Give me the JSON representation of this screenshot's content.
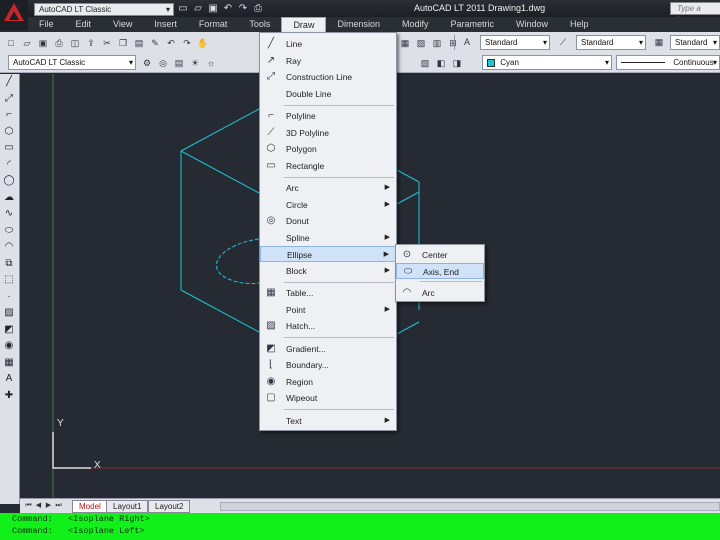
{
  "titlebar": {
    "workspace": "AutoCAD LT Classic",
    "app_title": "AutoCAD LT 2011    Drawing1.dwg",
    "search_placeholder": "Type a keyw"
  },
  "menubar": {
    "items": [
      {
        "label": "File"
      },
      {
        "label": "Edit"
      },
      {
        "label": "View"
      },
      {
        "label": "Insert"
      },
      {
        "label": "Format"
      },
      {
        "label": "Tools"
      },
      {
        "label": "Draw"
      },
      {
        "label": "Dimension"
      },
      {
        "label": "Modify"
      },
      {
        "label": "Parametric"
      },
      {
        "label": "Window"
      },
      {
        "label": "Help"
      }
    ],
    "active": "Draw"
  },
  "toolbar": {
    "text_style": "Standard",
    "dim_style": "Standard",
    "table_style": "Standard",
    "workspace": "AutoCAD LT Classic",
    "color": "Cyan",
    "linetype": "Continuous"
  },
  "draw_menu": {
    "items": [
      {
        "label": "Line",
        "icon": "line-icon",
        "submenu": false
      },
      {
        "label": "Ray",
        "icon": "ray-icon",
        "submenu": false
      },
      {
        "label": "Construction Line",
        "icon": "construction-line-icon",
        "submenu": false
      },
      {
        "label": "Double Line",
        "icon": "",
        "submenu": false
      },
      {
        "label": "Polyline",
        "icon": "polyline-icon",
        "submenu": false
      },
      {
        "label": "3D Polyline",
        "icon": "3d-polyline-icon",
        "submenu": false
      },
      {
        "label": "Polygon",
        "icon": "polygon-icon",
        "submenu": false
      },
      {
        "label": "Rectangle",
        "icon": "rectangle-icon",
        "submenu": false
      },
      {
        "label": "Arc",
        "icon": "",
        "submenu": true
      },
      {
        "label": "Circle",
        "icon": "",
        "submenu": true
      },
      {
        "label": "Donut",
        "icon": "donut-icon",
        "submenu": false
      },
      {
        "label": "Spline",
        "icon": "",
        "submenu": true
      },
      {
        "label": "Ellipse",
        "icon": "",
        "submenu": true
      },
      {
        "label": "Block",
        "icon": "",
        "submenu": true
      },
      {
        "label": "Table...",
        "icon": "table-icon",
        "submenu": false
      },
      {
        "label": "Point",
        "icon": "",
        "submenu": true
      },
      {
        "label": "Hatch...",
        "icon": "hatch-icon",
        "submenu": false
      },
      {
        "label": "Gradient...",
        "icon": "gradient-icon",
        "submenu": false
      },
      {
        "label": "Boundary...",
        "icon": "boundary-icon",
        "submenu": false
      },
      {
        "label": "Region",
        "icon": "region-icon",
        "submenu": false
      },
      {
        "label": "Wipeout",
        "icon": "wipeout-icon",
        "submenu": false
      },
      {
        "label": "Text",
        "icon": "",
        "submenu": true
      }
    ],
    "highlighted": "Ellipse"
  },
  "ellipse_submenu": {
    "items": [
      {
        "label": "Center",
        "icon": "ellipse-center-icon"
      },
      {
        "label": "Axis, End",
        "icon": "ellipse-axis-end-icon"
      },
      {
        "label": "Arc",
        "icon": "ellipse-arc-icon"
      }
    ],
    "highlighted": "Axis, End"
  },
  "layout_tabs": {
    "items": [
      {
        "label": "Model"
      },
      {
        "label": "Layout1"
      },
      {
        "label": "Layout2"
      }
    ],
    "active": "Model"
  },
  "ucs": {
    "x_label": "X",
    "y_label": "Y"
  },
  "command_line": {
    "lines": [
      "Command:   <Isoplane Right>",
      "Command:   <Isoplane Left>"
    ]
  },
  "colors": {
    "canvas": "#262b33",
    "drawing": "#18c6d6",
    "command_bg": "#12f01a",
    "highlight": "#cfe2f7"
  }
}
